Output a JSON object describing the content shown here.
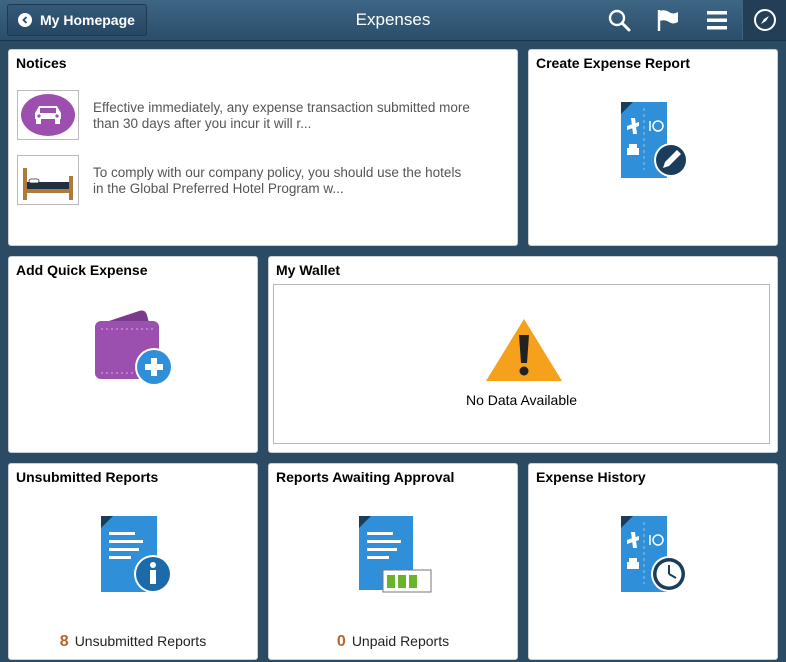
{
  "header": {
    "home_label": "My Homepage",
    "title": "Expenses",
    "icons": [
      "back-icon",
      "search-icon",
      "flag-icon",
      "menu-icon",
      "navbar-compass-icon"
    ]
  },
  "tiles": {
    "notices": {
      "title": "Notices",
      "items": [
        {
          "icon": "car-icon",
          "text": "Effective immediately, any expense transaction submitted more than 30 days after you incur it will r..."
        },
        {
          "icon": "bed-icon",
          "text": "To comply with our company policy, you should use the hotels in the Global Preferred Hotel Program w..."
        }
      ]
    },
    "create_expense_report": {
      "title": "Create Expense Report",
      "icon": "expense-report-edit-icon"
    },
    "add_quick_expense": {
      "title": "Add Quick Expense",
      "icon": "wallet-add-icon"
    },
    "my_wallet": {
      "title": "My Wallet",
      "icon": "warning-icon",
      "message": "No Data Available"
    },
    "unsubmitted_reports": {
      "title": "Unsubmitted Reports",
      "icon": "document-info-icon",
      "count": "8",
      "count_label": "Unsubmitted Reports"
    },
    "reports_awaiting_approval": {
      "title": "Reports Awaiting Approval",
      "icon": "document-progress-icon",
      "count": "0",
      "count_label": "Unpaid Reports"
    },
    "expense_history": {
      "title": "Expense History",
      "icon": "expense-report-clock-icon"
    }
  },
  "colors": {
    "header": "#2f5574",
    "background": "#2b4a63",
    "doc_blue": "#2f8fd8",
    "wallet_purple": "#9b4fae",
    "warning_orange": "#f5a11c",
    "count_orange": "#b5652a"
  }
}
